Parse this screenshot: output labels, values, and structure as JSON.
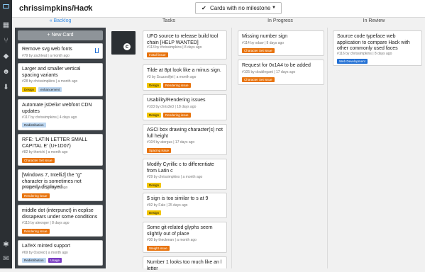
{
  "repo": {
    "name": "chrissimpkins/Hack"
  },
  "filter": {
    "label": "Cards with no milestone"
  },
  "columns": {
    "backlog": "« Backlog",
    "tasks": "Tasks",
    "in_progress": "In Progress",
    "in_review": "In Review"
  },
  "new_card_label": "+ New Card",
  "backlog_cards": [
    {
      "title": "Remove svg web fonts",
      "meta": "#79 by zachleat | a month ago",
      "labels": []
    },
    {
      "title": "Larger and smaller vertical spacing variants",
      "meta": "#28 by chrissimpkins | a month ago",
      "labels": [
        "Design",
        "enhancement"
      ]
    },
    {
      "title": "Automate jsDelivr webfont CDN updates",
      "meta": "#117 by chrissimpkins | 4 days ago",
      "labels": [
        "Redistribution"
      ]
    },
    {
      "title": "RFE: 'LATIN LETTER SMALL CAPITAL E' (U+1D07)",
      "meta": "#82 by therichi | a month ago",
      "labels": [
        "Character Set issue"
      ]
    },
    {
      "title": "[Windows 7, IntelliJ] the \"g\" character is sometimes not properly displayed",
      "meta": "#45 by feyanjo | a month ago",
      "labels": [
        "Rendering issue"
      ]
    },
    {
      "title": "middle dot (interpunct) in ecplise dissapears under some conditions",
      "meta": "#115 by alexnger | 8 days ago",
      "labels": [
        "Rendering issue"
      ]
    },
    {
      "title": "LaTeX minted support",
      "meta": "#69 by Osored | a month ago",
      "labels": [
        "Redistribution",
        "Usage"
      ]
    }
  ],
  "task_cards": [
    {
      "title": "UFO source to release build tool chain [HELP WANTED]",
      "meta": "#113 by chrissimpkins | 8 days ago",
      "labels": [
        "Install issue"
      ]
    },
    {
      "title": "Tilde at 8pt look like a minus sign.",
      "meta": "#3 by Scuzzoifjei | a month ago",
      "labels": [
        "Design",
        "Rendering issue"
      ]
    },
    {
      "title": "Usability/Rendering issues",
      "meta": "#103 by chris3e3 | 18 days ago",
      "labels": [
        "Design",
        "Rendering issue"
      ]
    },
    {
      "title": "ASCI box drawing character(s) not full height",
      "meta": "#104 by atergus | 17 days ago",
      "labels": [
        "Spacing issue"
      ]
    },
    {
      "title": "Modify Cyrillic c to differentiate from Latin c",
      "meta": "#29 by chrissimpkins | a month ago",
      "labels": [
        "Design"
      ]
    },
    {
      "title": "$ sign is too similar to s at 9",
      "meta": "#92 by Fale | 25 days ago",
      "labels": [
        "Design"
      ]
    },
    {
      "title": "Some git-related glyphs seem slightly out of place",
      "meta": "#30 by theckman | a month ago",
      "labels": [
        "Weight issue"
      ]
    },
    {
      "title": "Number 1 looks too much like an l letter",
      "meta": "",
      "labels": []
    }
  ],
  "progress_cards": [
    {
      "title": "Missing number sign",
      "meta": "#114 by xdaw | 8 days ago",
      "labels": [
        "Character Set issue"
      ]
    },
    {
      "title": "Request for 0x1A4 to be added",
      "meta": "#105 by doublegant | 17 days ago",
      "labels": [
        "Character Set issue"
      ]
    }
  ],
  "review_cards": [
    {
      "title": "Source code typeface web application to compare Hack with other commonly used faces",
      "meta": "#116 by chrissimpkins | 8 days ago",
      "labels": [
        "Web Development"
      ]
    }
  ],
  "label_colors": {
    "Design": "#f2c500",
    "enhancement": "#bcd6f0",
    "Redistribution": "#bcd6f0",
    "Character Set issue": "#e8730c",
    "Rendering issue": "#e8730c",
    "Install issue": "#e8730c",
    "Spacing issue": "#e8730c",
    "Weight issue": "#e8730c",
    "Usage": "#7a3ec2",
    "Web Development": "#1f6ed4"
  }
}
